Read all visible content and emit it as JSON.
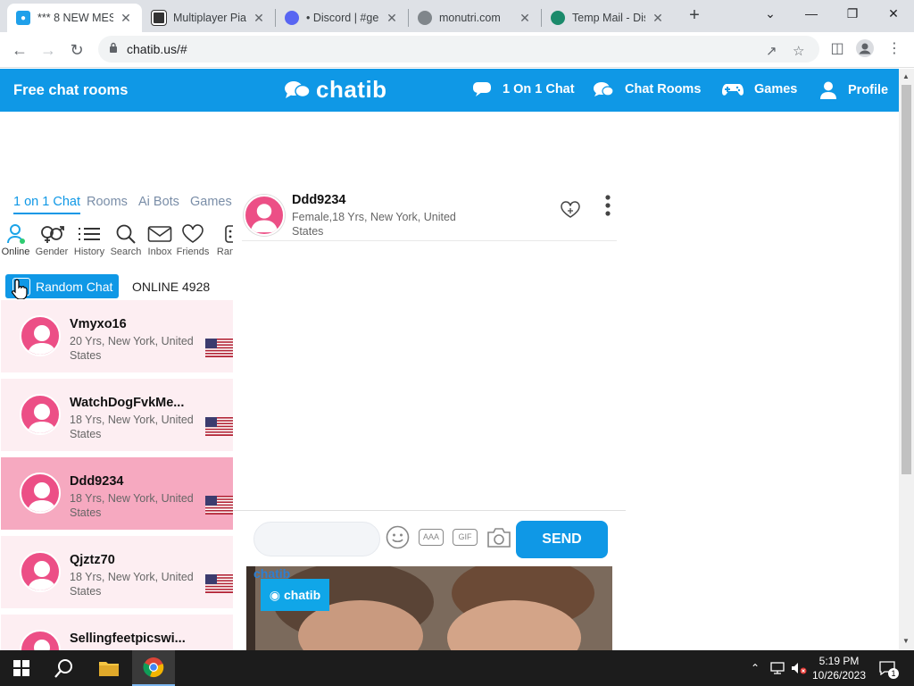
{
  "browser": {
    "tabs": [
      {
        "title": "*** 8 NEW MES",
        "favicon": "chatib-favicon",
        "active": true
      },
      {
        "title": "Multiplayer Pia",
        "favicon": "piano-favicon",
        "active": false
      },
      {
        "title": "• Discord | #gen",
        "favicon": "discord-favicon",
        "active": false
      },
      {
        "title": "monutri.com",
        "favicon": "globe-favicon",
        "active": false
      },
      {
        "title": "Temp Mail - Dis",
        "favicon": "tempmail-favicon",
        "active": false
      }
    ],
    "new_tab": "+",
    "url": "chatib.us/#"
  },
  "header": {
    "left_title": "Free chat rooms",
    "logo_text": "chatib",
    "nav": [
      {
        "label": "1 On 1 Chat",
        "icon": "speech-bubble-icon"
      },
      {
        "label": "Chat Rooms",
        "icon": "chat-bubbles-icon"
      },
      {
        "label": "Games",
        "icon": "gamepad-icon"
      },
      {
        "label": "Profile",
        "icon": "user-icon"
      }
    ]
  },
  "sidebar": {
    "tabs": [
      "1 on 1 Chat",
      "Rooms",
      "Ai Bots",
      "Games"
    ],
    "active_tab": "1 on 1 Chat",
    "icon_buttons": [
      {
        "label": "Online",
        "icon": "online-user-icon"
      },
      {
        "label": "Gender",
        "icon": "gender-icon"
      },
      {
        "label": "History",
        "icon": "history-list-icon"
      },
      {
        "label": "Search",
        "icon": "search-icon"
      },
      {
        "label": "Inbox",
        "icon": "inbox-icon"
      },
      {
        "label": "Friends",
        "icon": "heart-icon"
      },
      {
        "label": "Ran",
        "icon": "random-dice-icon"
      }
    ],
    "random_chat_label": "Random Chat",
    "online_label": "ONLINE 4928",
    "users": [
      {
        "name": "Vmyxo16",
        "info": "20 Yrs, New York, United States",
        "selected": false
      },
      {
        "name": "WatchDogFvkMe...",
        "info": "18 Yrs, New York, United States",
        "selected": false
      },
      {
        "name": "Ddd9234",
        "info": "18 Yrs, New York, United States",
        "selected": true
      },
      {
        "name": "Qjztz70",
        "info": "18 Yrs, New York, United States",
        "selected": false
      },
      {
        "name": "Sellingfeetpicswi...",
        "info": "",
        "selected": false
      }
    ]
  },
  "chat": {
    "name": "Ddd9234",
    "info": "Female,18 Yrs, New York, United States",
    "input_placeholder": "",
    "aaa_label": "AAA",
    "gif_label": "GIF",
    "send_label": "SEND"
  },
  "ad": {
    "logo_text": "chatib",
    "logo_text_overlay": "chatib"
  },
  "taskbar": {
    "time": "5:19 PM",
    "date": "10/26/2023",
    "notifications": "1"
  },
  "colors": {
    "brand": "#0f98e6",
    "avatar_pink": "#ec4f86",
    "row_bg": "#fdeef2",
    "row_selected": "#f6a9c0"
  }
}
